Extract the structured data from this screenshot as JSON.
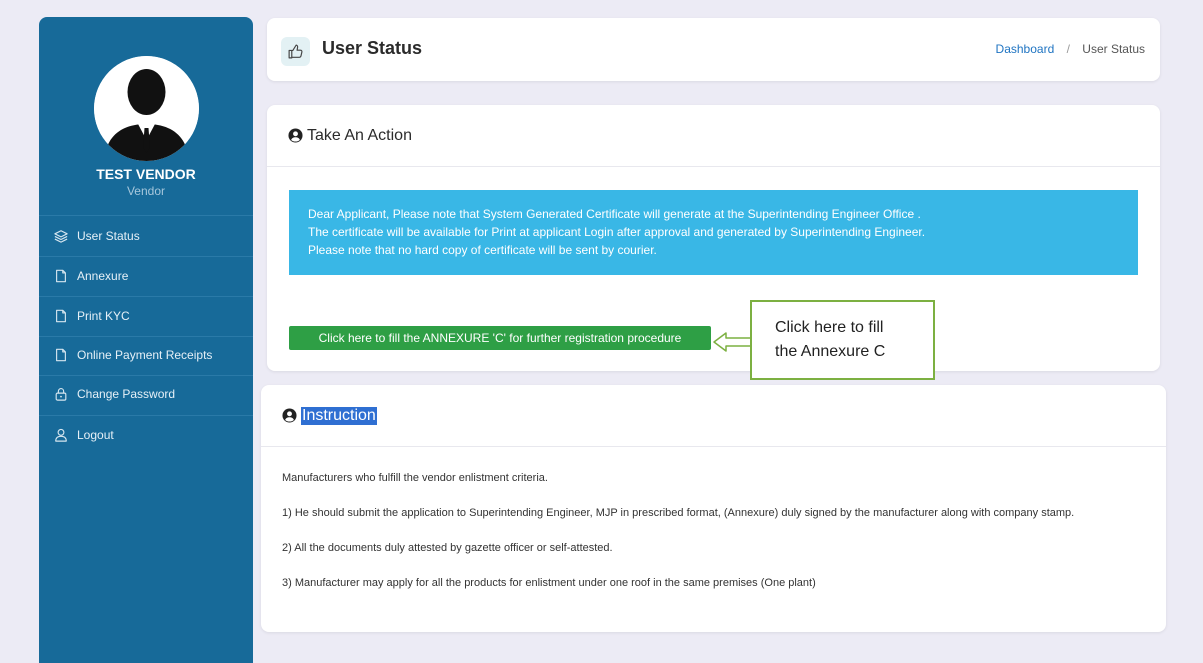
{
  "sidebar": {
    "user_name": "TEST VENDOR",
    "user_role": "Vendor",
    "items": [
      {
        "label": "User Status",
        "icon": "layers-icon"
      },
      {
        "label": "Annexure",
        "icon": "file-icon"
      },
      {
        "label": "Print KYC",
        "icon": "file-icon"
      },
      {
        "label": "Online Payment Receipts",
        "icon": "file-icon"
      },
      {
        "label": "Change Password",
        "icon": "lock-icon"
      },
      {
        "label": "Logout",
        "icon": "user-icon"
      }
    ]
  },
  "header": {
    "title": "User Status",
    "icon": "thumbs-up-icon",
    "breadcrumb": {
      "link": "Dashboard",
      "separator": "/",
      "current": "User Status"
    }
  },
  "action_card": {
    "title": "Take An Action",
    "info_lines": [
      "Dear Applicant, Please note that System Generated Certificate will generate at the Superintending Engineer Office .",
      "The certificate will be available for Print at applicant Login after approval and generated by Superintending Engineer.",
      "Please note that no hard copy of certificate will be sent by courier."
    ],
    "annexure_button": "Click here to fill the ANNEXURE 'C' for further registration procedure"
  },
  "callout": {
    "line1": "Click here to fill",
    "line2": "the Annexure C"
  },
  "instruction_card": {
    "title": "Instruction",
    "lines": [
      "Manufacturers who fulfill the vendor enlistment criteria.",
      "1) He should submit the application to Superintending Engineer, MJP in prescribed format, (Annexure) duly signed by the manufacturer along with company stamp.",
      "2) All the documents duly attested by gazette officer or self-attested.",
      "3) Manufacturer may apply for all the products for enlistment under one roof in the same premises (One plant)"
    ]
  },
  "colors": {
    "sidebar_bg": "#176a99",
    "info_bg": "#39b7e6",
    "button_green": "#2e9f45",
    "callout_border": "#7cb041",
    "highlight": "#2f6fd2"
  }
}
